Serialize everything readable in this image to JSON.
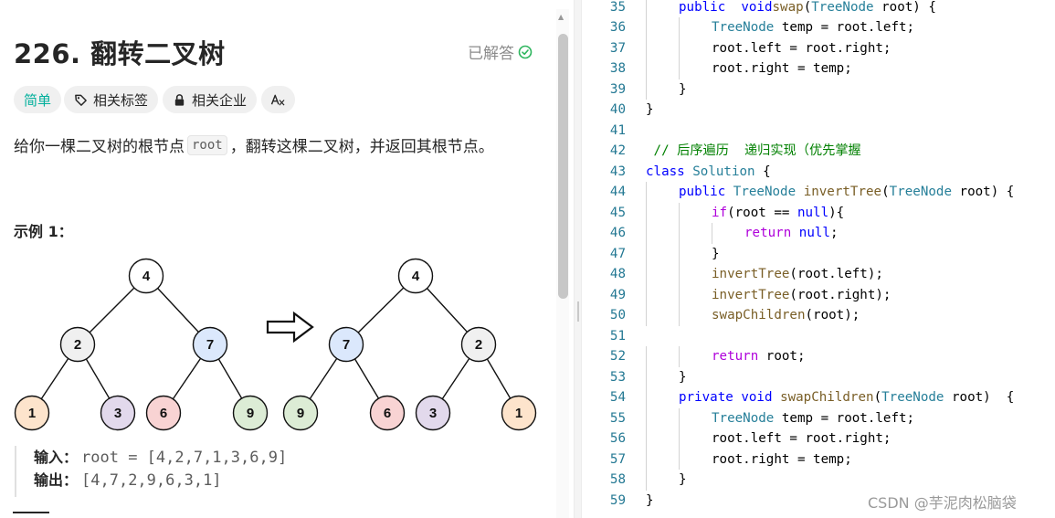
{
  "problem": {
    "title": "226. 翻转二叉树",
    "solved_label": "已解答",
    "tags": {
      "difficulty": "简单",
      "topics": "相关标签",
      "companies": "相关企业",
      "translate": "A文"
    },
    "description": {
      "before": "给你一棵二叉树的根节点",
      "code": "root",
      "after": "，翻转这棵二叉树，并返回其根节点。"
    },
    "example_heading": "示例 1：",
    "example": {
      "input_label": "输入：",
      "input_value": "root = [4,2,7,1,3,6,9]",
      "output_label": "输出：",
      "output_value": "[4,7,2,9,6,3,1]"
    },
    "trees": {
      "original": [
        "4",
        "2",
        "7",
        "1",
        "3",
        "6",
        "9"
      ],
      "inverted": [
        "4",
        "7",
        "2",
        "9",
        "6",
        "3",
        "1"
      ]
    },
    "node_colors": {
      "root": "#ffffff",
      "2": "#f0f0f0",
      "7": "#dbe8fc",
      "1": "#fde4cc",
      "3": "#e2d9ec",
      "6": "#f8d3d3",
      "9": "#dcecd5"
    }
  },
  "editor": {
    "lines": [
      {
        "n": "35",
        "indent": 1,
        "tokens": [
          [
            "kw",
            "public"
          ],
          [
            "",
            "  "
          ],
          [
            "kw",
            "void"
          ],
          [
            "",
            ""
          ],
          [
            "fn",
            "swap"
          ],
          [
            "",
            "("
          ],
          [
            "type",
            "TreeNode"
          ],
          [
            "",
            " root) {"
          ]
        ]
      },
      {
        "n": "36",
        "indent": 2,
        "tokens": [
          [
            "type",
            "TreeNode"
          ],
          [
            "",
            " temp = root.left;"
          ]
        ]
      },
      {
        "n": "37",
        "indent": 2,
        "tokens": [
          [
            "",
            "root.left = root.right;"
          ]
        ]
      },
      {
        "n": "38",
        "indent": 2,
        "tokens": [
          [
            "",
            "root.right = temp;"
          ]
        ]
      },
      {
        "n": "39",
        "indent": 1,
        "tokens": [
          [
            "",
            "}"
          ]
        ]
      },
      {
        "n": "40",
        "indent": 0,
        "tokens": [
          [
            "",
            "}"
          ]
        ]
      },
      {
        "n": "41",
        "indent": 0,
        "tokens": []
      },
      {
        "n": "42",
        "indent": 0,
        "tokens": [
          [
            "comment",
            " // 后序遍历  递归实现（优先掌握"
          ]
        ]
      },
      {
        "n": "43",
        "indent": 0,
        "tokens": [
          [
            "kw",
            "class"
          ],
          [
            "",
            " "
          ],
          [
            "type",
            "Solution"
          ],
          [
            "",
            " {"
          ]
        ]
      },
      {
        "n": "44",
        "indent": 1,
        "tokens": [
          [
            "kw",
            "public"
          ],
          [
            "",
            " "
          ],
          [
            "type",
            "TreeNode"
          ],
          [
            "",
            " "
          ],
          [
            "fn",
            "invertTree"
          ],
          [
            "",
            "("
          ],
          [
            "type",
            "TreeNode"
          ],
          [
            "",
            " root) {"
          ]
        ]
      },
      {
        "n": "45",
        "indent": 2,
        "tokens": [
          [
            "ctrl",
            "if"
          ],
          [
            "",
            "(root == "
          ],
          [
            "kw",
            "null"
          ],
          [
            "",
            "){"
          ]
        ]
      },
      {
        "n": "46",
        "indent": 3,
        "tokens": [
          [
            "ctrl",
            "return"
          ],
          [
            "",
            " "
          ],
          [
            "kw",
            "null"
          ],
          [
            "",
            ";"
          ]
        ]
      },
      {
        "n": "47",
        "indent": 2,
        "tokens": [
          [
            "",
            "}"
          ]
        ]
      },
      {
        "n": "48",
        "indent": 2,
        "tokens": [
          [
            "fn",
            "invertTree"
          ],
          [
            "",
            "(root.left);"
          ]
        ]
      },
      {
        "n": "49",
        "indent": 2,
        "tokens": [
          [
            "fn",
            "invertTree"
          ],
          [
            "",
            "(root.right);"
          ]
        ]
      },
      {
        "n": "50",
        "indent": 2,
        "tokens": [
          [
            "fn",
            "swapChildren"
          ],
          [
            "",
            "(root);"
          ]
        ]
      },
      {
        "n": "51",
        "indent": 0,
        "tokens": []
      },
      {
        "n": "52",
        "indent": 2,
        "tokens": [
          [
            "ctrl",
            "return"
          ],
          [
            "",
            " root;"
          ]
        ]
      },
      {
        "n": "53",
        "indent": 1,
        "tokens": [
          [
            "",
            "}"
          ]
        ]
      },
      {
        "n": "54",
        "indent": 1,
        "tokens": [
          [
            "kw",
            "private"
          ],
          [
            "",
            " "
          ],
          [
            "kw",
            "void"
          ],
          [
            "",
            " "
          ],
          [
            "fn",
            "swapChildren"
          ],
          [
            "",
            "("
          ],
          [
            "type",
            "TreeNode"
          ],
          [
            "",
            " root)  {"
          ]
        ]
      },
      {
        "n": "55",
        "indent": 2,
        "tokens": [
          [
            "type",
            "TreeNode"
          ],
          [
            "",
            " temp = root.left;"
          ]
        ]
      },
      {
        "n": "56",
        "indent": 2,
        "tokens": [
          [
            "",
            "root.left = root.right;"
          ]
        ]
      },
      {
        "n": "57",
        "indent": 2,
        "tokens": [
          [
            "",
            "root.right = temp;"
          ]
        ]
      },
      {
        "n": "58",
        "indent": 1,
        "tokens": [
          [
            "",
            "}"
          ]
        ]
      },
      {
        "n": "59",
        "indent": 0,
        "tokens": [
          [
            "",
            "}"
          ]
        ]
      }
    ]
  },
  "watermark": "CSDN @芋泥肉松脑袋"
}
